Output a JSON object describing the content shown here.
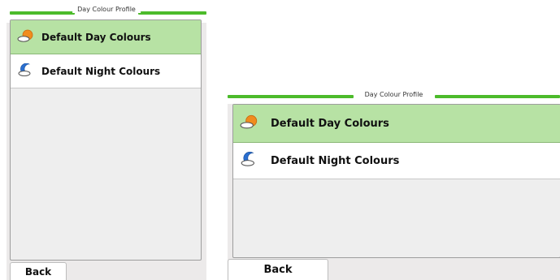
{
  "screens": [
    {
      "title": "Day Colour Profile",
      "items": [
        {
          "label": "Default Day Colours",
          "icon": "sun-cloud-icon",
          "selected": true
        },
        {
          "label": "Default Night Colours",
          "icon": "moon-cloud-icon",
          "selected": false
        }
      ],
      "back_label": "Back"
    },
    {
      "title": "Day Colour Profile",
      "items": [
        {
          "label": "Default Day Colours",
          "icon": "sun-cloud-icon",
          "selected": true
        },
        {
          "label": "Default Night Colours",
          "icon": "moon-cloud-icon",
          "selected": false
        }
      ],
      "back_label": "Back"
    }
  ],
  "colors": {
    "title_line": "#4cbb2b",
    "selected_row": "#b7e2a4",
    "panel_bg": "#eceaea"
  }
}
